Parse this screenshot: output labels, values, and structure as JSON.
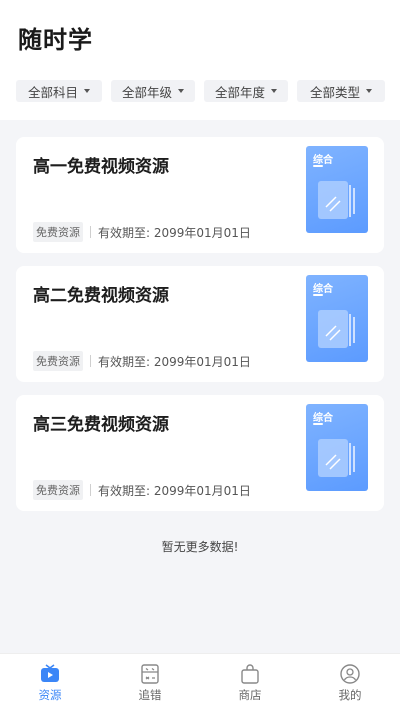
{
  "header": {
    "title": "随时学",
    "filters": [
      "全部科目",
      "全部年级",
      "全部年度",
      "全部类型"
    ]
  },
  "resources": [
    {
      "title": "高一免费视频资源",
      "tag": "免费资源",
      "validity": "有效期至: 2099年01月01日",
      "cover_label": "综合"
    },
    {
      "title": "高二免费视频资源",
      "tag": "免费资源",
      "validity": "有效期至: 2099年01月01日",
      "cover_label": "综合"
    },
    {
      "title": "高三免费视频资源",
      "tag": "免费资源",
      "validity": "有效期至: 2099年01月01日",
      "cover_label": "综合"
    }
  ],
  "end_message": "暂无更多数据!",
  "tabbar": {
    "active": "resources",
    "items": [
      {
        "label": "资源",
        "icon": "tv-icon"
      },
      {
        "label": "追错",
        "icon": "error-book-icon"
      },
      {
        "label": "商店",
        "icon": "shopping-bag-icon"
      },
      {
        "label": "我的",
        "icon": "user-icon"
      }
    ]
  },
  "colors": {
    "accent": "#3b86f7",
    "cover": "#6aa6ff",
    "background": "#f4f5f8"
  }
}
